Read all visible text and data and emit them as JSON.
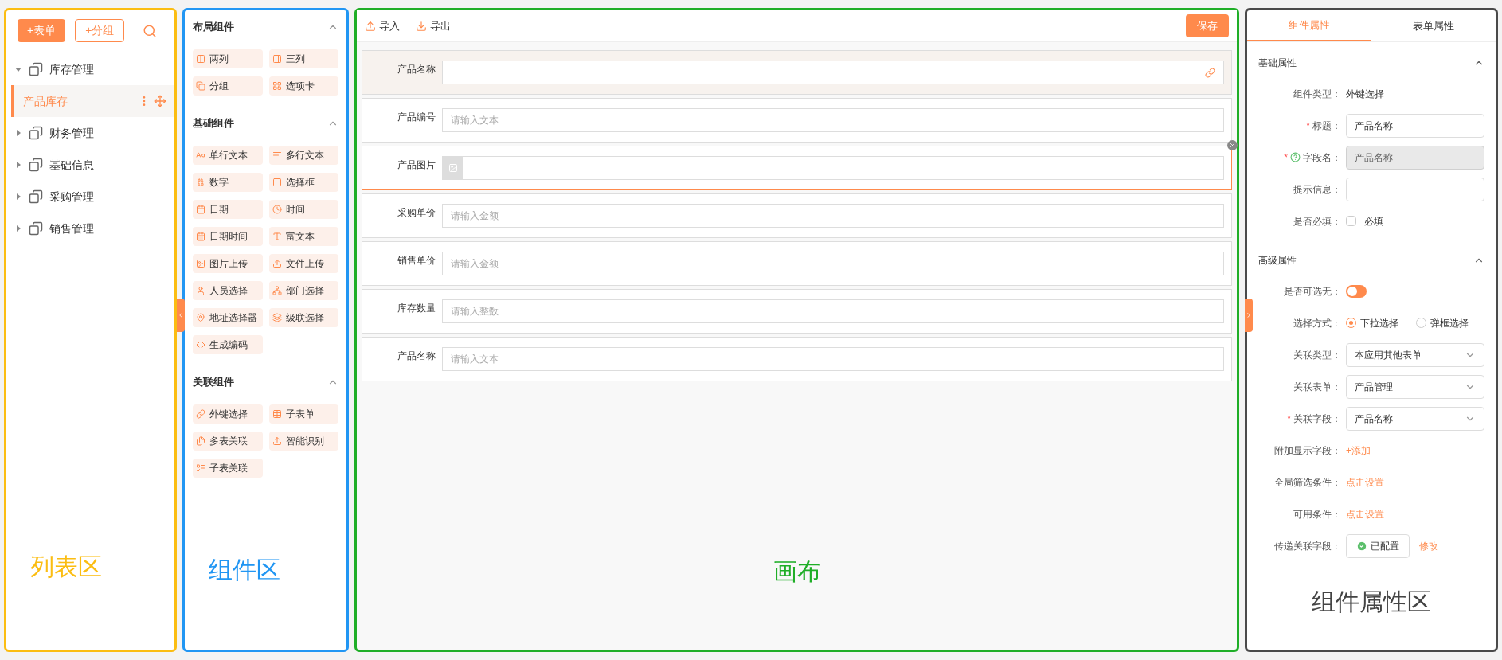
{
  "list_panel": {
    "buttons": [
      {
        "label": "+表单",
        "kind": "primary"
      },
      {
        "label": "+分组",
        "kind": "outline"
      }
    ],
    "tree": [
      {
        "label": "库存管理",
        "expanded": true,
        "children": [
          {
            "label": "产品库存",
            "selected": true
          }
        ]
      },
      {
        "label": "财务管理",
        "expanded": false
      },
      {
        "label": "基础信息",
        "expanded": false
      },
      {
        "label": "采购管理",
        "expanded": false
      },
      {
        "label": "销售管理",
        "expanded": false
      }
    ],
    "annotation": "列表区"
  },
  "component_panel": {
    "groups": [
      {
        "title": "布局组件",
        "expanded": true,
        "items": [
          "两列",
          "三列",
          "分组",
          "选项卡"
        ]
      },
      {
        "title": "基础组件",
        "expanded": true,
        "items": [
          "单行文本",
          "多行文本",
          "数字",
          "选择框",
          "日期",
          "时间",
          "日期时间",
          "富文本",
          "图片上传",
          "文件上传",
          "人员选择",
          "部门选择",
          "地址选择器",
          "级联选择",
          "生成编码"
        ]
      },
      {
        "title": "关联组件",
        "expanded": true,
        "items": [
          "外键选择",
          "子表单",
          "多表关联",
          "智能识别",
          "子表关联"
        ]
      }
    ],
    "annotation": "组件区"
  },
  "canvas": {
    "toolbar": [
      {
        "label": "导入",
        "kind": "import"
      },
      {
        "label": "导出",
        "kind": "export"
      }
    ],
    "save": "保存",
    "fields": [
      {
        "label": "产品名称",
        "kind": "link",
        "hovered": true,
        "selected": false
      },
      {
        "label": "产品编号",
        "kind": "text",
        "placeholder": "请输入文本",
        "hovered": false,
        "selected": false
      },
      {
        "label": "产品图片",
        "kind": "image",
        "hovered": false,
        "selected": true
      },
      {
        "label": "采购单价",
        "kind": "text",
        "placeholder": "请输入金额",
        "hovered": false,
        "selected": false
      },
      {
        "label": "销售单价",
        "kind": "text",
        "placeholder": "请输入金额",
        "hovered": false,
        "selected": false
      },
      {
        "label": "库存数量",
        "kind": "text",
        "placeholder": "请输入整数",
        "hovered": false,
        "selected": false
      },
      {
        "label": "产品名称",
        "kind": "text",
        "placeholder": "请输入文本",
        "hovered": false,
        "selected": false
      }
    ],
    "annotation": "画布"
  },
  "properties_panel": {
    "tabs": [
      {
        "label": "组件属性",
        "selected": true
      },
      {
        "label": "表单属性",
        "selected": false
      }
    ],
    "sections": [
      {
        "title": "基础属性",
        "expanded": true,
        "rows": [
          {
            "kind": "text",
            "label": "组件类型：",
            "value": "外键选择"
          },
          {
            "kind": "input",
            "label": "标题：",
            "required_mark": "*",
            "disabled": false,
            "value": "产品名称"
          },
          {
            "kind": "input",
            "label": "字段名：",
            "required_mark": "*",
            "help": true,
            "disabled": true,
            "value": "产品名称"
          },
          {
            "kind": "input",
            "label": "提示信息：",
            "disabled": false
          },
          {
            "kind": "checkbox",
            "label": "是否必填：",
            "checked": false,
            "option": "必填"
          }
        ]
      },
      {
        "title": "高级属性",
        "expanded": true,
        "rows": [
          {
            "kind": "switch",
            "label": "是否可选无：",
            "on": false
          },
          {
            "kind": "radio",
            "label": "选择方式：",
            "options": [
              {
                "label": "下拉选择",
                "selected": true
              },
              {
                "label": "弹框选择",
                "selected": false
              }
            ]
          },
          {
            "kind": "select",
            "label": "关联类型：",
            "value": "本应用其他表单"
          },
          {
            "kind": "select",
            "label": "关联表单：",
            "value": "产品管理"
          },
          {
            "kind": "select",
            "label": "关联字段：",
            "required_mark": "*",
            "value": "产品名称"
          },
          {
            "kind": "link",
            "label": "附加显示字段：",
            "value": "+添加"
          },
          {
            "kind": "link",
            "label": "全局筛选条件：",
            "value": "点击设置"
          },
          {
            "kind": "link",
            "label": "可用条件：",
            "value": "点击设置"
          },
          {
            "kind": "status",
            "label": "传递关联字段：",
            "value": "已配置",
            "action": "修改"
          }
        ]
      }
    ],
    "annotation": "组件属性区"
  }
}
